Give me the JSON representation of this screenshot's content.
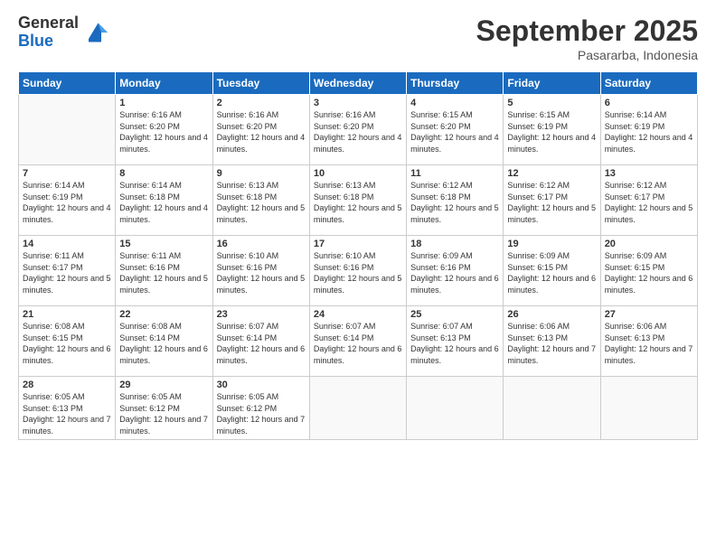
{
  "logo": {
    "general": "General",
    "blue": "Blue"
  },
  "title": "September 2025",
  "location": "Pasararba, Indonesia",
  "days_header": [
    "Sunday",
    "Monday",
    "Tuesday",
    "Wednesday",
    "Thursday",
    "Friday",
    "Saturday"
  ],
  "weeks": [
    [
      {
        "num": "",
        "empty": true
      },
      {
        "num": "1",
        "sunrise": "6:16 AM",
        "sunset": "6:20 PM",
        "daylight": "12 hours and 4 minutes."
      },
      {
        "num": "2",
        "sunrise": "6:16 AM",
        "sunset": "6:20 PM",
        "daylight": "12 hours and 4 minutes."
      },
      {
        "num": "3",
        "sunrise": "6:16 AM",
        "sunset": "6:20 PM",
        "daylight": "12 hours and 4 minutes."
      },
      {
        "num": "4",
        "sunrise": "6:15 AM",
        "sunset": "6:20 PM",
        "daylight": "12 hours and 4 minutes."
      },
      {
        "num": "5",
        "sunrise": "6:15 AM",
        "sunset": "6:19 PM",
        "daylight": "12 hours and 4 minutes."
      },
      {
        "num": "6",
        "sunrise": "6:14 AM",
        "sunset": "6:19 PM",
        "daylight": "12 hours and 4 minutes."
      }
    ],
    [
      {
        "num": "7",
        "sunrise": "6:14 AM",
        "sunset": "6:19 PM",
        "daylight": "12 hours and 4 minutes."
      },
      {
        "num": "8",
        "sunrise": "6:14 AM",
        "sunset": "6:18 PM",
        "daylight": "12 hours and 4 minutes."
      },
      {
        "num": "9",
        "sunrise": "6:13 AM",
        "sunset": "6:18 PM",
        "daylight": "12 hours and 5 minutes."
      },
      {
        "num": "10",
        "sunrise": "6:13 AM",
        "sunset": "6:18 PM",
        "daylight": "12 hours and 5 minutes."
      },
      {
        "num": "11",
        "sunrise": "6:12 AM",
        "sunset": "6:18 PM",
        "daylight": "12 hours and 5 minutes."
      },
      {
        "num": "12",
        "sunrise": "6:12 AM",
        "sunset": "6:17 PM",
        "daylight": "12 hours and 5 minutes."
      },
      {
        "num": "13",
        "sunrise": "6:12 AM",
        "sunset": "6:17 PM",
        "daylight": "12 hours and 5 minutes."
      }
    ],
    [
      {
        "num": "14",
        "sunrise": "6:11 AM",
        "sunset": "6:17 PM",
        "daylight": "12 hours and 5 minutes."
      },
      {
        "num": "15",
        "sunrise": "6:11 AM",
        "sunset": "6:16 PM",
        "daylight": "12 hours and 5 minutes."
      },
      {
        "num": "16",
        "sunrise": "6:10 AM",
        "sunset": "6:16 PM",
        "daylight": "12 hours and 5 minutes."
      },
      {
        "num": "17",
        "sunrise": "6:10 AM",
        "sunset": "6:16 PM",
        "daylight": "12 hours and 5 minutes."
      },
      {
        "num": "18",
        "sunrise": "6:09 AM",
        "sunset": "6:16 PM",
        "daylight": "12 hours and 6 minutes."
      },
      {
        "num": "19",
        "sunrise": "6:09 AM",
        "sunset": "6:15 PM",
        "daylight": "12 hours and 6 minutes."
      },
      {
        "num": "20",
        "sunrise": "6:09 AM",
        "sunset": "6:15 PM",
        "daylight": "12 hours and 6 minutes."
      }
    ],
    [
      {
        "num": "21",
        "sunrise": "6:08 AM",
        "sunset": "6:15 PM",
        "daylight": "12 hours and 6 minutes."
      },
      {
        "num": "22",
        "sunrise": "6:08 AM",
        "sunset": "6:14 PM",
        "daylight": "12 hours and 6 minutes."
      },
      {
        "num": "23",
        "sunrise": "6:07 AM",
        "sunset": "6:14 PM",
        "daylight": "12 hours and 6 minutes."
      },
      {
        "num": "24",
        "sunrise": "6:07 AM",
        "sunset": "6:14 PM",
        "daylight": "12 hours and 6 minutes."
      },
      {
        "num": "25",
        "sunrise": "6:07 AM",
        "sunset": "6:13 PM",
        "daylight": "12 hours and 6 minutes."
      },
      {
        "num": "26",
        "sunrise": "6:06 AM",
        "sunset": "6:13 PM",
        "daylight": "12 hours and 7 minutes."
      },
      {
        "num": "27",
        "sunrise": "6:06 AM",
        "sunset": "6:13 PM",
        "daylight": "12 hours and 7 minutes."
      }
    ],
    [
      {
        "num": "28",
        "sunrise": "6:05 AM",
        "sunset": "6:13 PM",
        "daylight": "12 hours and 7 minutes."
      },
      {
        "num": "29",
        "sunrise": "6:05 AM",
        "sunset": "6:12 PM",
        "daylight": "12 hours and 7 minutes."
      },
      {
        "num": "30",
        "sunrise": "6:05 AM",
        "sunset": "6:12 PM",
        "daylight": "12 hours and 7 minutes."
      },
      {
        "num": "",
        "empty": true
      },
      {
        "num": "",
        "empty": true
      },
      {
        "num": "",
        "empty": true
      },
      {
        "num": "",
        "empty": true
      }
    ]
  ]
}
